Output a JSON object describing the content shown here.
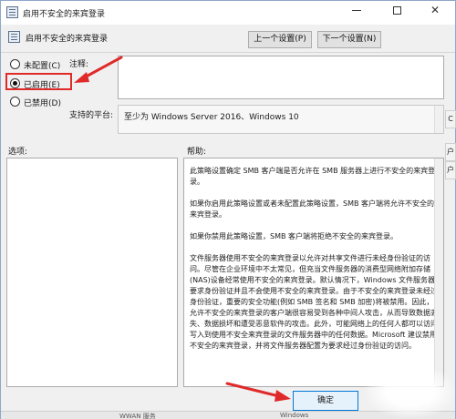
{
  "window": {
    "title": "启用不安全的来宾登录",
    "minimize_icon": "minimize-icon",
    "maximize_icon": "maximize-icon",
    "close_glyph": "✕"
  },
  "header": {
    "setting_name": "启用不安全的来宾登录",
    "prev_button": "上一个设置(P)",
    "next_button": "下一个设置(N)"
  },
  "state": {
    "options": [
      {
        "label": "未配置(C)",
        "selected": false
      },
      {
        "label": "已启用(E)",
        "selected": true
      },
      {
        "label": "已禁用(D)",
        "selected": false
      }
    ]
  },
  "fields": {
    "comment_label": "注释:",
    "comment_value": "",
    "platform_label": "支持的平台:",
    "platform_value": "至少为 Windows Server 2016、Windows 10"
  },
  "panels": {
    "options_label": "选项:",
    "help_label": "帮助:",
    "help_paragraphs": [
      "此策略设置确定 SMB 客户端是否允许在 SMB 服务器上进行不安全的来宾登录。",
      "如果你启用此策略设置或者未配置此策略设置，SMB 客户端将允许不安全的来宾登录。",
      "如果你禁用此策略设置，SMB 客户端将拒绝不安全的来宾登录。",
      "文件服务器使用不安全的来宾登录以允许对共享文件进行未经身份验证的访问。尽管在企业环境中不太常见，但充当文件服务器的消费型网络附加存储(NAS)设备经常使用不安全的来宾登录。默认情况下，Windows 文件服务器要求身份验证并且不会使用不安全的来宾登录。由于不安全的来宾登录未经过身份验证，重要的安全功能(例如 SMB 签名和 SMB 加密)将被禁用。因此，允许不安全的来宾登录的客户端很容易受到各种中间人攻击，从而导致数据丢失、数据损坏和遭受恶意软件的攻击。此外，可能网络上的任何人都可以访问写入到使用不安全来宾登录的文件服务器中的任何数据。Microsoft 建议禁用不安全的来宾登录，并将文件服务器配置为要求经过身份验证的访问。"
    ]
  },
  "footer": {
    "ok_button": "确定"
  },
  "background": {
    "taskbar_item_1": "WWAN 服务",
    "taskbar_item_2": "Windows",
    "right_fragments": [
      "C",
      "户",
      "户"
    ]
  },
  "annotation_color": "#e02a2a"
}
